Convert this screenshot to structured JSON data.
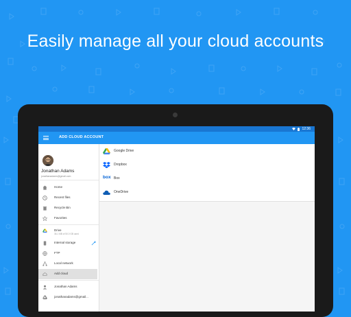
{
  "headline": "Easily manage all your cloud accounts",
  "status_bar": {
    "time": "12:36"
  },
  "app_bar": {
    "title": "ADD CLOUD ACCOUNT"
  },
  "user": {
    "name": "Jonathan Adams",
    "email": "jonathanadams@gmail.com"
  },
  "drawer": {
    "items": [
      {
        "label": "Home",
        "icon": "home-icon"
      },
      {
        "label": "Recent files",
        "icon": "clock-icon"
      },
      {
        "label": "Recycle Bin",
        "icon": "trash-icon"
      },
      {
        "label": "Favorites",
        "icon": "star-icon"
      },
      {
        "label": "Drive",
        "sub": "36.1 MB of 50.0 GB used",
        "icon": "drive-icon"
      },
      {
        "label": "Internal storage",
        "icon": "phone-icon"
      },
      {
        "label": "FTP",
        "icon": "globe-icon"
      },
      {
        "label": "Local network",
        "icon": "network-icon"
      },
      {
        "label": "Add cloud",
        "icon": "cloud-icon",
        "selected": true
      },
      {
        "label": "Jonathan Adams",
        "icon": "person-icon"
      },
      {
        "label": "jonathanadams@gmail...",
        "icon": "drive-icon"
      }
    ]
  },
  "cloud_services": [
    {
      "label": "Google Drive",
      "icon": "google-drive-icon"
    },
    {
      "label": "Dropbox",
      "icon": "dropbox-icon"
    },
    {
      "label": "Box",
      "icon": "box-icon",
      "logo_text": "box"
    },
    {
      "label": "OneDrive",
      "icon": "onedrive-icon"
    }
  ],
  "colors": {
    "background": "#2196F3",
    "app_bar": "#2196F3",
    "status_bar": "#1976D2",
    "tablet": "#1a1a1a"
  }
}
